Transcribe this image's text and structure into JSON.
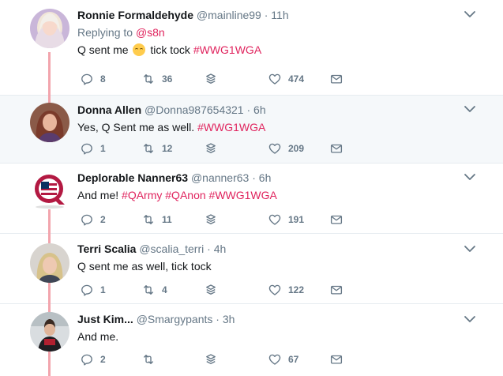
{
  "tweets": [
    {
      "name": "Ronnie Formaldehyde",
      "handle": "@mainline99",
      "dot": "·",
      "time": "11h",
      "replying_prefix": "Replying to ",
      "replying_to": "@s8n",
      "text_before": "Q sent me ",
      "text_after": " tick tock ",
      "hashtags": [
        "#WWG1WGA"
      ],
      "replies": "8",
      "retweets": "36",
      "likes": "474"
    },
    {
      "name": "Donna Allen",
      "handle": "@Donna987654321",
      "dot": "·",
      "time": "6h",
      "text": "Yes, Q Sent me as well. ",
      "hashtags": [
        "#WWG1WGA"
      ],
      "replies": "1",
      "retweets": "12",
      "likes": "209"
    },
    {
      "name": "Deplorable Nanner63",
      "handle": "@nanner63",
      "dot": "·",
      "time": "6h",
      "text": "And me! ",
      "hashtags": [
        "#QArmy",
        "#QAnon",
        "#WWG1WGA"
      ],
      "replies": "2",
      "retweets": "11",
      "likes": "191"
    },
    {
      "name": "Terri Scalia",
      "handle": "@scalia_terri",
      "dot": "·",
      "time": "4h",
      "text": "Q sent me as well, tick tock",
      "replies": "1",
      "retweets": "4",
      "likes": "122"
    },
    {
      "name": "Just Kim...",
      "handle": "@Smargypants",
      "dot": "·",
      "time": "3h",
      "text": "And me.",
      "replies": "2",
      "retweets": "",
      "likes": "67"
    }
  ],
  "icons": {
    "reply": "reply-icon",
    "retweet": "retweet-icon",
    "stack": "stack-icon",
    "like": "heart-icon",
    "message": "envelope-icon",
    "caret": "chevron-down-icon"
  },
  "colors": {
    "accent": "#e0245e",
    "thread_line": "#f2a5ad",
    "secondary_text": "#657786",
    "highlight_bg": "#f5f8fa"
  }
}
